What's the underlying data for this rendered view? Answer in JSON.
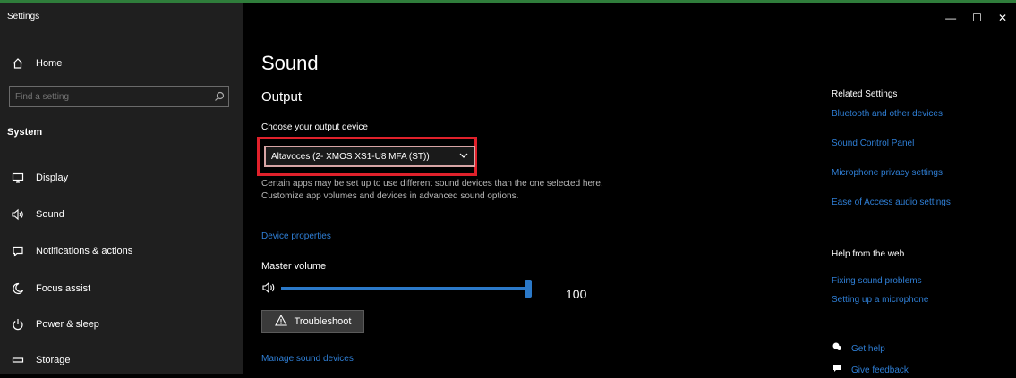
{
  "window": {
    "title": "Settings",
    "controls": {
      "minimize": "—",
      "maximize": "☐",
      "close": "✕"
    }
  },
  "sidebar": {
    "home": "Home",
    "search_placeholder": "Find a setting",
    "section": "System",
    "items": [
      {
        "label": "Display",
        "icon": "display-icon"
      },
      {
        "label": "Sound",
        "icon": "speaker-icon"
      },
      {
        "label": "Notifications & actions",
        "icon": "notifications-icon"
      },
      {
        "label": "Focus assist",
        "icon": "moon-icon"
      },
      {
        "label": "Power & sleep",
        "icon": "power-icon"
      },
      {
        "label": "Storage",
        "icon": "storage-icon"
      }
    ]
  },
  "main": {
    "title": "Sound",
    "output_header": "Output",
    "choose_label": "Choose your output device",
    "device_value": "Altavoces (2- XMOS XS1-U8 MFA (ST))",
    "info_text": "Certain apps may be set up to use different sound devices than the one selected here. Customize app volumes and devices in advanced sound options.",
    "device_properties": "Device properties",
    "master_volume_label": "Master volume",
    "volume_value": "100",
    "volume_level": 1.0,
    "troubleshoot": "Troubleshoot",
    "manage_devices": "Manage sound devices"
  },
  "related": {
    "header": "Related Settings",
    "links": [
      "Bluetooth and other devices",
      "Sound Control Panel",
      "Microphone privacy settings",
      "Ease of Access audio settings"
    ]
  },
  "help": {
    "header": "Help from the web",
    "links": [
      "Fixing sound problems",
      "Setting up a microphone"
    ],
    "get_help": "Get help",
    "give_feedback": "Give feedback"
  },
  "colors": {
    "accent": "#2b79c9",
    "link": "#2f7fd6",
    "highlight": "#e0212b",
    "sidebar_bg": "#1f1f1f"
  }
}
